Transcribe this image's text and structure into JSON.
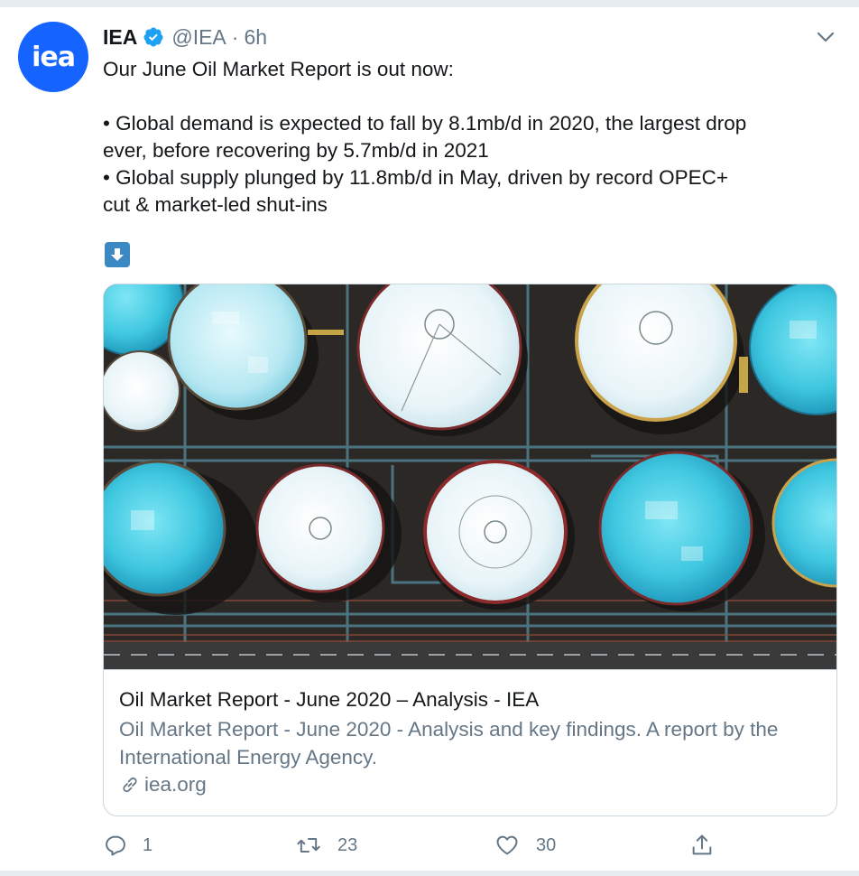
{
  "tweet": {
    "author_name": "IEA",
    "handle": "@IEA",
    "separator": "·",
    "time": "6h",
    "avatar_text": "iea",
    "text_lines": [
      "Our June Oil Market Report is out now:",
      "",
      "• Global demand is expected to fall by 8.1mb/d in 2020, the largest drop",
      "ever, before recovering by 5.7mb/d in 2021",
      "• Global supply plunged by 11.8mb/d in May, driven by record OPEC+",
      "cut & market-led shut-ins"
    ],
    "emoji": "down-arrow-emoji"
  },
  "card": {
    "title": "Oil Market Report - June 2020 – Analysis - IEA",
    "description": "Oil Market Report - June 2020 - Analysis and key findings. A report by the International Energy Agency.",
    "domain": "iea.org",
    "image_alt": "aerial-oil-storage-tanks"
  },
  "actions": {
    "reply_count": "1",
    "retweet_count": "23",
    "like_count": "30"
  },
  "colors": {
    "brand_blue": "#1664ff",
    "verified_blue": "#1da1f2",
    "secondary_text": "#657786",
    "border": "#ccd6dd"
  }
}
